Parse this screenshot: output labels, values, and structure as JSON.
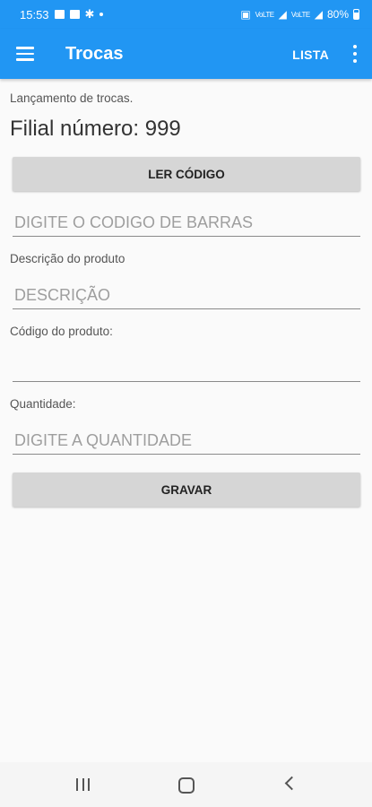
{
  "status_bar": {
    "time": "15:53",
    "battery": "80%",
    "network_labels": [
      "VoLTE",
      "VoLTE"
    ]
  },
  "app_bar": {
    "title": "Trocas",
    "action_label": "LISTA"
  },
  "form": {
    "subtitle": "Lançamento de trocas.",
    "branch": "Filial número: 999",
    "scan_button": "LER CÓDIGO",
    "barcode_placeholder": "DIGITE O CODIGO DE BARRAS",
    "description_label": "Descrição do produto",
    "description_placeholder": "DESCRIÇÃO",
    "code_label": "Código do produto:",
    "code_value": "",
    "quantity_label": "Quantidade:",
    "quantity_placeholder": "DIGITE A QUANTIDADE",
    "save_button": "GRAVAR"
  },
  "colors": {
    "primary": "#2196f3",
    "button_bg": "#d6d6d6",
    "background": "#fafafa"
  },
  "icons": [
    "menu-icon",
    "more-vert-icon",
    "recent-apps-icon",
    "home-icon",
    "back-icon"
  ]
}
